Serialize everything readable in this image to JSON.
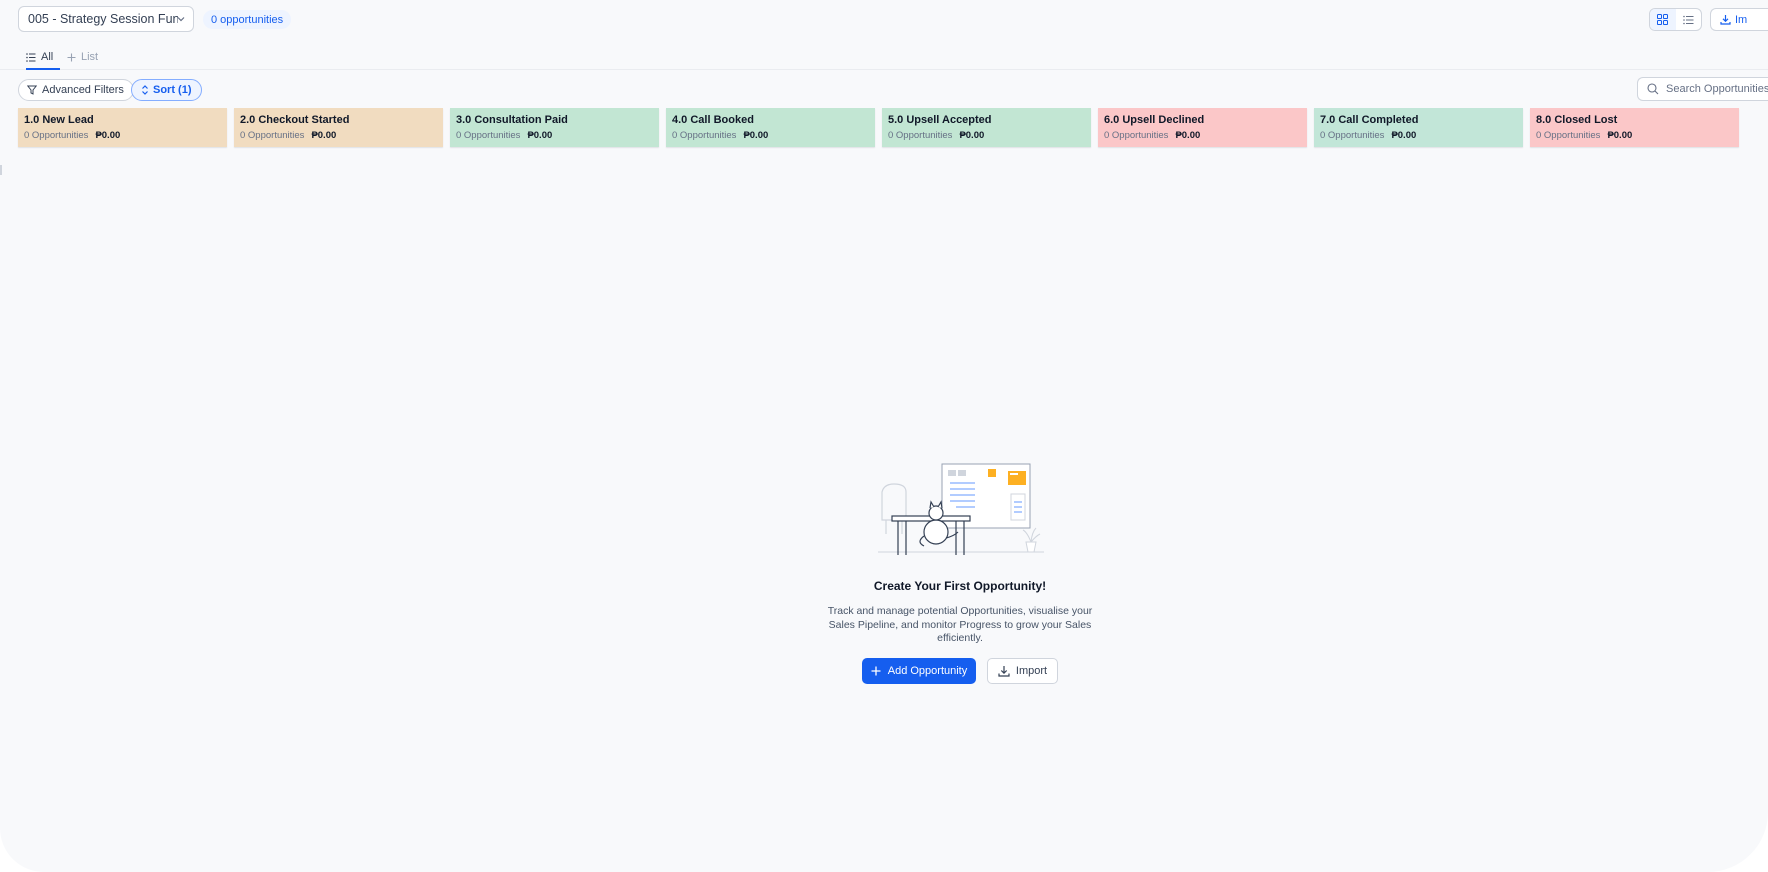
{
  "header": {
    "pipeline_name": "005 - Strategy Session Fun...",
    "opportunity_count": "0 opportunities",
    "import_label": "Im"
  },
  "tabs": [
    {
      "label": "All",
      "active": true,
      "icon": "list-icon"
    },
    {
      "label": "List",
      "active": false,
      "icon": "plus-icon"
    }
  ],
  "filters": {
    "advanced_label": "Advanced Filters",
    "sort_label": "Sort (1)",
    "search_placeholder": "Search Opportunities"
  },
  "stages": [
    {
      "name": "1.0 New Lead",
      "count": "0 Opportunities",
      "amount": "₱0.00",
      "color": "#f1dcc0"
    },
    {
      "name": "2.0 Checkout Started",
      "count": "0 Opportunities",
      "amount": "₱0.00",
      "color": "#f1dcc0"
    },
    {
      "name": "3.0 Consultation Paid",
      "count": "0 Opportunities",
      "amount": "₱0.00",
      "color": "#c2e6d3"
    },
    {
      "name": "4.0 Call Booked",
      "count": "0 Opportunities",
      "amount": "₱0.00",
      "color": "#c2e6d3"
    },
    {
      "name": "5.0 Upsell Accepted",
      "count": "0 Opportunities",
      "amount": "₱0.00",
      "color": "#c2e6d3"
    },
    {
      "name": "6.0 Upsell Declined",
      "count": "0 Opportunities",
      "amount": "₱0.00",
      "color": "#fbc7c8"
    },
    {
      "name": "7.0 Call Completed",
      "count": "0 Opportunities",
      "amount": "₱0.00",
      "color": "#c2e6d8"
    },
    {
      "name": "8.0 Closed Lost",
      "count": "0 Opportunities",
      "amount": "₱0.00",
      "color": "#fbc7c8"
    }
  ],
  "empty_state": {
    "title": "Create Your First Opportunity!",
    "description": "Track and manage potential Opportunities, visualise your Sales Pipeline, and monitor Progress to grow your Sales efficiently.",
    "add_button": "Add Opportunity",
    "import_button": "Import"
  },
  "colors": {
    "accent": "#155eef",
    "background": "#f8f9fb"
  }
}
